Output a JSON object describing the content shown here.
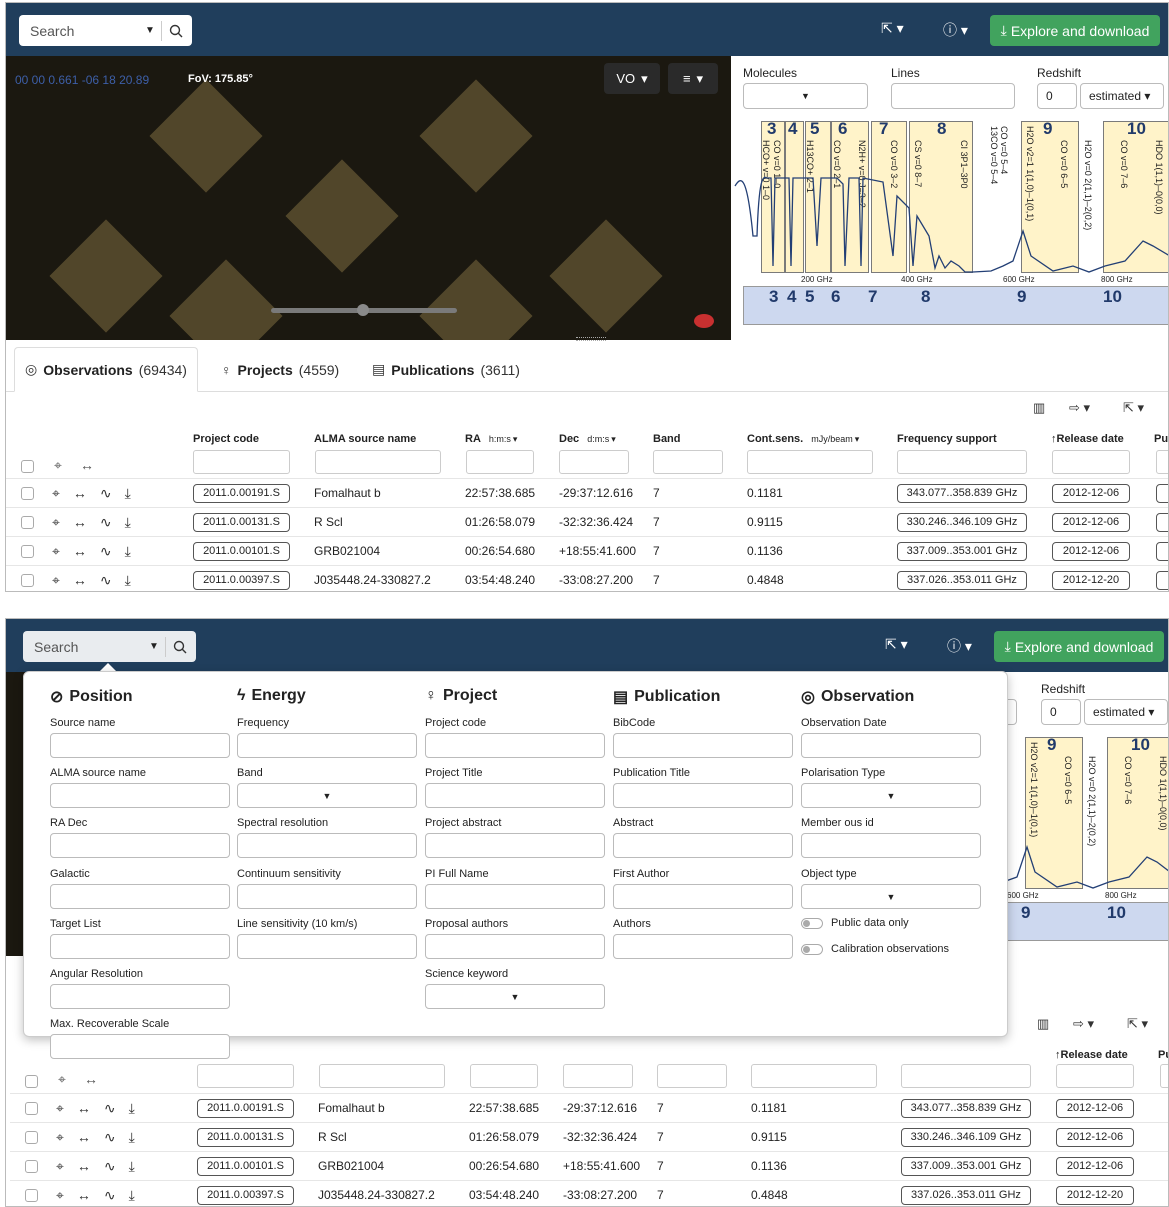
{
  "search": {
    "placeholder": "Search"
  },
  "topbar": {
    "explore_label": "Explore and download"
  },
  "sky": {
    "coordinates": "00 00 0.661 -06 18 20.89",
    "fov": "FoV: 175.85°",
    "vo_label": "VO"
  },
  "spectrum": {
    "molecules_label": "Molecules",
    "lines_label": "Lines",
    "redshift_label": "Redshift",
    "redshift_value": "0",
    "redshift_mode": "estimated",
    "bands": [
      "3",
      "4",
      "5",
      "6",
      "7",
      "8",
      "9",
      "10"
    ],
    "lines": [
      "HCO+ v=0 1–0",
      "CO v=0 1–0",
      "H13CO+ 2–1",
      "CO v=0 2–1",
      "N2H+ v=0 J=3–2",
      "CO v=0 3–2",
      "CS v=0 8–7",
      "CI 3P1–3P0",
      "13CO v=0 5–4",
      "CO v=0 5–4",
      "H2O v2=1 1(1,0)–1(0,1)",
      "CO v=0 6–5",
      "H2O v=0 2(1,1)–2(0,2)",
      "CO v=0 7–6",
      "HDO 1(1,1)–0(0,0)"
    ],
    "axis": [
      "200 GHz",
      "400 GHz",
      "600 GHz",
      "800 GHz"
    ],
    "mini_bands": [
      "3",
      "4",
      "5",
      "6",
      "7",
      "8",
      "9",
      "10"
    ]
  },
  "tabs": [
    {
      "label": "Observations",
      "count": "(69434)"
    },
    {
      "label": "Projects",
      "count": "(4559)"
    },
    {
      "label": "Publications",
      "count": "(3611)"
    }
  ],
  "table": {
    "headers": {
      "project_code": "Project code",
      "source_name": "ALMA source name",
      "ra": "RA",
      "ra_unit": "h:m:s",
      "dec": "Dec",
      "dec_unit": "d:m:s",
      "band": "Band",
      "cont_sens": "Cont.sens.",
      "cont_unit": "mJy/beam",
      "freq": "Frequency support",
      "release": "Release date",
      "pub": "Pu"
    },
    "rows": [
      {
        "code": "2011.0.00191.S",
        "source": "Fomalhaut b",
        "ra": "22:57:38.685",
        "dec": "-29:37:12.616",
        "band": "7",
        "sens": "0.1181",
        "freq": "343.077..358.839 GHz",
        "release": "2012-12-06"
      },
      {
        "code": "2011.0.00131.S",
        "source": "R Scl",
        "ra": "01:26:58.079",
        "dec": "-32:32:36.424",
        "band": "7",
        "sens": "0.9115",
        "freq": "330.246..346.109 GHz",
        "release": "2012-12-06"
      },
      {
        "code": "2011.0.00101.S",
        "source": "GRB021004",
        "ra": "00:26:54.680",
        "dec": "+18:55:41.600",
        "band": "7",
        "sens": "0.1136",
        "freq": "337.009..353.001 GHz",
        "release": "2012-12-06"
      },
      {
        "code": "2011.0.00397.S",
        "source": "J035448.24-330827.2",
        "ra": "03:54:48.240",
        "dec": "-33:08:27.200",
        "band": "7",
        "sens": "0.4848",
        "freq": "337.026..353.011 GHz",
        "release": "2012-12-20"
      }
    ]
  },
  "panel": {
    "position": {
      "title": "Position",
      "fields": [
        "Source name",
        "ALMA source name",
        "RA Dec",
        "Galactic",
        "Target List",
        "Angular Resolution",
        "Max. Recoverable Scale"
      ]
    },
    "energy": {
      "title": "Energy",
      "fields": [
        "Frequency",
        "Band",
        "Spectral resolution",
        "Continuum sensitivity",
        "Line sensitivity (10 km/s)"
      ]
    },
    "project": {
      "title": "Project",
      "fields": [
        "Project code",
        "Project Title",
        "Project abstract",
        "PI Full Name",
        "Proposal authors",
        "Science keyword"
      ]
    },
    "publication": {
      "title": "Publication",
      "fields": [
        "BibCode",
        "Publication Title",
        "Abstract",
        "First Author",
        "Authors"
      ]
    },
    "observation": {
      "title": "Observation",
      "fields": [
        "Observation Date",
        "Polarisation Type",
        "Member ous id",
        "Object type"
      ],
      "toggles": [
        "Public data only",
        "Calibration observations"
      ]
    }
  },
  "colors": {
    "topbar": "#203e5c",
    "explore": "#41a35e",
    "band_fill": "#fff3c9",
    "band_text": "#213a6b"
  }
}
